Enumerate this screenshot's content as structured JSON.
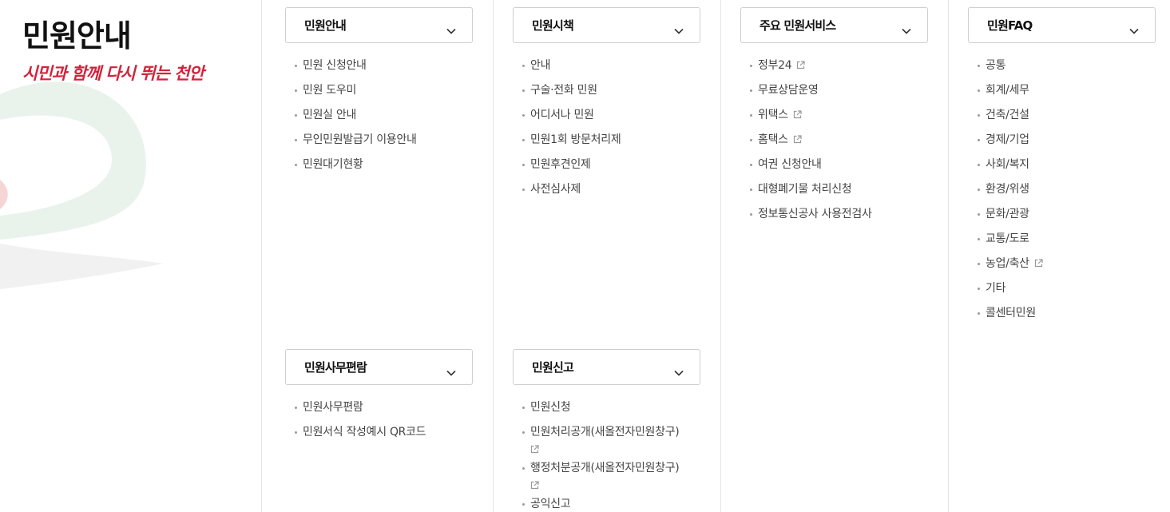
{
  "page": {
    "title": "민원안내",
    "slogan": "시민과 함께 다시 뛰는 천안"
  },
  "columns": [
    {
      "sections": [
        {
          "label": "민원안내",
          "items": [
            {
              "text": "민원 신청안내",
              "external": false
            },
            {
              "text": "민원 도우미",
              "external": false
            },
            {
              "text": "민원실 안내",
              "external": false
            },
            {
              "text": "무인민원발급기 이용안내",
              "external": false
            },
            {
              "text": "민원대기현황",
              "external": false
            }
          ]
        },
        {
          "label": "민원사무편람",
          "items": [
            {
              "text": "민원사무편람",
              "external": false
            },
            {
              "text": "민원서식 작성예시 QR코드",
              "external": false
            }
          ]
        }
      ]
    },
    {
      "sections": [
        {
          "label": "민원시책",
          "items": [
            {
              "text": "안내",
              "external": false
            },
            {
              "text": "구술·전화 민원",
              "external": false
            },
            {
              "text": "어디서나 민원",
              "external": false
            },
            {
              "text": "민원1회 방문처리제",
              "external": false
            },
            {
              "text": "민원후견인제",
              "external": false
            },
            {
              "text": "사전심사제",
              "external": false
            }
          ]
        },
        {
          "label": "민원신고",
          "items": [
            {
              "text": "민원신청",
              "external": false
            },
            {
              "text": "민원처리공개(새올전자민원창구)",
              "external": true,
              "wrap_icon": true
            },
            {
              "text": "행정처분공개(새올전자민원창구)",
              "external": true,
              "wrap_icon": true
            },
            {
              "text": "공익신고",
              "external": false
            }
          ]
        }
      ]
    },
    {
      "sections": [
        {
          "label": "주요 민원서비스",
          "items": [
            {
              "text": "정부24",
              "external": true
            },
            {
              "text": "무료상담운영",
              "external": false
            },
            {
              "text": "위택스",
              "external": true
            },
            {
              "text": "홈택스",
              "external": true
            },
            {
              "text": "여권 신청안내",
              "external": false
            },
            {
              "text": "대형폐기물 처리신청",
              "external": false
            },
            {
              "text": "정보통신공사 사용전검사",
              "external": false
            }
          ]
        }
      ]
    },
    {
      "sections": [
        {
          "label": "민원FAQ",
          "items": [
            {
              "text": "공통",
              "external": false
            },
            {
              "text": "회계/세무",
              "external": false
            },
            {
              "text": "건축/건설",
              "external": false
            },
            {
              "text": "경제/기업",
              "external": false
            },
            {
              "text": "사회/복지",
              "external": false
            },
            {
              "text": "환경/위생",
              "external": false
            },
            {
              "text": "문화/관광",
              "external": false
            },
            {
              "text": "교통/도로",
              "external": false
            },
            {
              "text": "농업/축산",
              "external": true
            },
            {
              "text": "기타",
              "external": false
            },
            {
              "text": "콜센터민원",
              "external": false
            }
          ]
        }
      ]
    }
  ],
  "icons": {
    "section_toggle": "chevron-down-icon",
    "external_link": "external-link-icon"
  },
  "colors": {
    "slogan_red": "#d2233c",
    "swoosh_green": "#dfeee3",
    "swoosh_red": "#f6d5d5"
  }
}
